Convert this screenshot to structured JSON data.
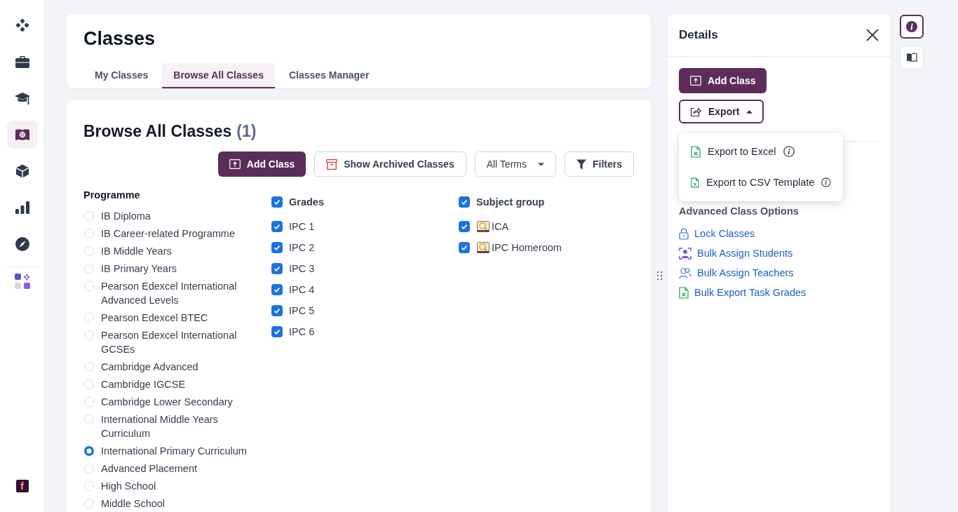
{
  "sidebar": {
    "items": [
      {
        "selected": false
      },
      {
        "selected": false
      },
      {
        "selected": false
      },
      {
        "selected": true
      },
      {
        "selected": false
      },
      {
        "selected": false
      },
      {
        "selected": false
      }
    ],
    "brand": {
      "mark": "f"
    }
  },
  "header": {
    "title": "Classes",
    "tabs": [
      {
        "label": "My Classes",
        "selected": false
      },
      {
        "label": "Browse All Classes",
        "selected": true
      },
      {
        "label": "Classes Manager",
        "selected": false
      }
    ]
  },
  "browse": {
    "title": "Browse All Classes",
    "count": "(1)",
    "toolbar": {
      "add_button": "Add Class",
      "archived_button": "Show Archived Classes",
      "term_select": "All Terms",
      "filters_button": "Filters"
    },
    "programme": {
      "heading": "Programme",
      "options": [
        {
          "label": "IB Diploma",
          "selected": false
        },
        {
          "label": "IB Career-related Programme",
          "selected": false
        },
        {
          "label": "IB Middle Years",
          "selected": false
        },
        {
          "label": "IB Primary Years",
          "selected": false
        },
        {
          "label": "Pearson Edexcel International Advanced Levels",
          "selected": false
        },
        {
          "label": "Pearson Edexcel BTEC",
          "selected": false
        },
        {
          "label": "Pearson Edexcel International GCSEs",
          "selected": false
        },
        {
          "label": "Cambridge Advanced",
          "selected": false
        },
        {
          "label": "Cambridge IGCSE",
          "selected": false
        },
        {
          "label": "Cambridge Lower Secondary",
          "selected": false
        },
        {
          "label": "International Middle Years Curriculum",
          "selected": false
        },
        {
          "label": "International Primary Curriculum",
          "selected": true
        },
        {
          "label": "Advanced Placement",
          "selected": false
        },
        {
          "label": "High School",
          "selected": false
        },
        {
          "label": "Middle School",
          "selected": false
        }
      ]
    },
    "grades": {
      "heading": "Grades",
      "checked": true,
      "options": [
        {
          "label": "IPC 1",
          "checked": true
        },
        {
          "label": "IPC 2",
          "checked": true
        },
        {
          "label": "IPC 3",
          "checked": true
        },
        {
          "label": "IPC 4",
          "checked": true
        },
        {
          "label": "IPC 5",
          "checked": true
        },
        {
          "label": "IPC 6",
          "checked": true
        }
      ]
    },
    "subject_group": {
      "heading": "Subject group",
      "checked": true,
      "options": [
        {
          "label": "ICA",
          "checked": true
        },
        {
          "label": "IPC Homeroom",
          "checked": true
        }
      ]
    }
  },
  "details": {
    "title": "Details",
    "add_button": "Add Class",
    "export_button": {
      "label": "Export",
      "expanded": true
    },
    "export_menu": [
      {
        "label": "Export to Excel"
      },
      {
        "label": "Export to CSV Template"
      }
    ],
    "advanced": {
      "heading": "Advanced Class Options",
      "links": [
        "Lock Classes",
        "Bulk Assign Students",
        "Bulk Assign Teachers",
        "Bulk Export Task Grades"
      ]
    }
  },
  "side_rail": {
    "buttons": [
      {
        "selected": true
      },
      {
        "selected": false
      }
    ]
  }
}
